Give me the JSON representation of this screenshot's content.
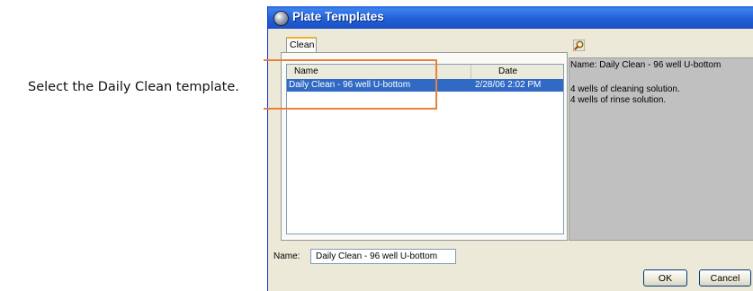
{
  "callout": {
    "text": "Select the Daily Clean template."
  },
  "window": {
    "title": "Plate Templates"
  },
  "tabs": [
    {
      "label": "Clean",
      "selected": true
    }
  ],
  "list": {
    "columns": {
      "name": "Name",
      "date": "Date"
    },
    "rows": [
      {
        "name": "Daily Clean - 96 well U-bottom",
        "date": "2/28/06 2:02 PM",
        "selected": true
      }
    ]
  },
  "name_field": {
    "label": "Name:",
    "value": "Daily Clean - 96 well U-bottom"
  },
  "preview": {
    "name_line": "Name: Daily Clean - 96 well U-bottom",
    "lines": [
      "4 wells of cleaning solution.",
      "4 wells of rinse solution."
    ]
  },
  "buttons": {
    "ok": "OK",
    "cancel": "Cancel"
  },
  "icons": {
    "title": "app-window-icon",
    "preview": "magnifier-icon"
  },
  "colors": {
    "callout_border": "#e8813a",
    "selection": "#316ac5",
    "titlebar": "#2360d6"
  }
}
